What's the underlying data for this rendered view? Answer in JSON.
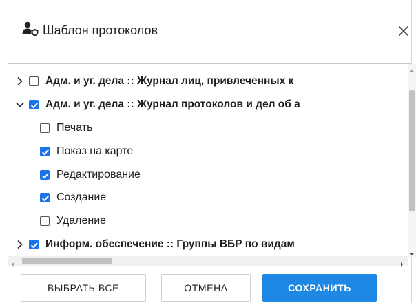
{
  "dialog": {
    "title": "Шаблон протоколов",
    "header_icon": "user-shield-icon",
    "close_icon": "close-icon"
  },
  "tree": {
    "items": [
      {
        "label": "Адм. и уг. дела :: Журнал лиц, привлеченных к",
        "bold": true,
        "checked": false,
        "expanded": false,
        "level": 0
      },
      {
        "label": "Адм. и уг. дела :: Журнал протоколов и дел об а",
        "bold": true,
        "checked": true,
        "expanded": true,
        "level": 0
      },
      {
        "label": "Печать",
        "bold": false,
        "checked": false,
        "level": 1
      },
      {
        "label": "Показ на карте",
        "bold": false,
        "checked": true,
        "level": 1
      },
      {
        "label": "Редактирование",
        "bold": false,
        "checked": true,
        "level": 1
      },
      {
        "label": "Создание",
        "bold": false,
        "checked": true,
        "level": 1
      },
      {
        "label": "Удаление",
        "bold": false,
        "checked": false,
        "level": 1
      },
      {
        "label": "Информ. обеспечение :: Группы ВБР по видам",
        "bold": true,
        "checked": true,
        "expanded": false,
        "level": 0
      }
    ]
  },
  "footer": {
    "select_all_label": "ВЫБРАТЬ ВСЕ",
    "cancel_label": "ОТМЕНА",
    "save_label": "СОХРАНИТЬ"
  },
  "colors": {
    "accent": "#1e88e5",
    "checkbox_checked": "#1a73e8",
    "scroll_thumb": "#c1c1c1"
  }
}
